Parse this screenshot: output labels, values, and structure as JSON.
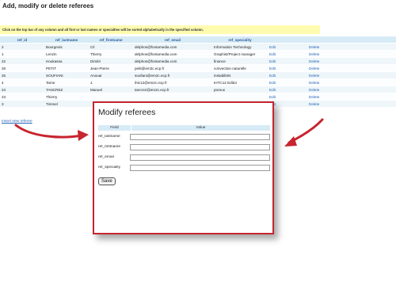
{
  "page": {
    "title": "Add, modify or delete referees",
    "hint": "Click on the top bar of any column and all first or last names or specialties will be sorted alphabetically in the specified column.",
    "insert_link": "Insert new referee"
  },
  "table": {
    "columns": [
      "ref_id",
      "ref_lastname",
      "ref_firstname",
      "ref_email",
      "ref_speciality",
      "",
      ""
    ],
    "rows": [
      [
        "2",
        "Bourgeois",
        "Cil",
        "delphos@fontamedia.com",
        "Information Technology",
        "Edit",
        "Delete"
      ],
      [
        "1",
        "Lenzin",
        "Thierry",
        "delphos@fontamedia.com",
        "Graphist/Project manager",
        "Edit",
        "Delete"
      ],
      [
        "22",
        "Houkassa",
        "Dimitri",
        "delphos@fontamedia.com",
        "finance",
        "Edit",
        "Delete"
      ],
      [
        "26",
        "PETIT",
        "Jean-Pierre",
        "petit@em2c.ecp.fr",
        "convection naturelle",
        "Edit",
        "Delete"
      ],
      [
        "25",
        "SOUFIANI",
        "Anouar",
        "soufiani@em2c.ecp.fr",
        "instabilités",
        "Edit",
        "Delete"
      ],
      [
        "4",
        "Tarne",
        "J.",
        "ihtc12@em2c.ecp.fr",
        "IHTC12 Editor",
        "Edit",
        "Delete"
      ],
      [
        "24",
        "TANCREZ",
        "Manuel",
        "tancrez@em2c.ecp.fr",
        "poreux",
        "Edit",
        "Delete"
      ],
      [
        "23",
        "Thierry",
        "",
        "",
        "",
        "Edit",
        "Delete"
      ],
      [
        "3",
        "Timmel",
        "",
        "",
        "",
        "Edit",
        "Delete"
      ]
    ]
  },
  "modal": {
    "title": "Modify referees",
    "field_header": "Field",
    "value_header": "Value",
    "fields": [
      {
        "label": "ref_lastname",
        "value": ""
      },
      {
        "label": "ref_firstname",
        "value": ""
      },
      {
        "label": "ref_email",
        "value": ""
      },
      {
        "label": "ref_speciality",
        "value": ""
      }
    ],
    "save_label": "Save"
  },
  "colors": {
    "accent_red": "#c7252f",
    "header_blue": "#d7ebf6",
    "link_blue": "#2463b5",
    "hint_yellow": "#fffcb0"
  }
}
